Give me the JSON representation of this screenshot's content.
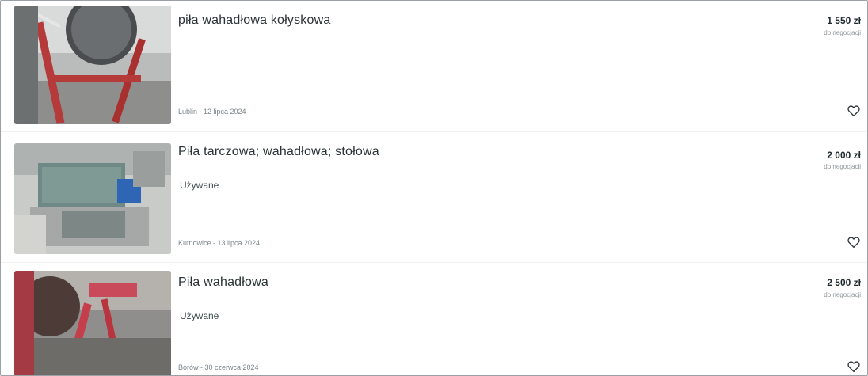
{
  "listings": [
    {
      "title": "piła wahadłowa kołyskowa",
      "condition": "",
      "location_date": "Lublin - 12 lipca 2024",
      "price": "1 550 zł",
      "negotiable": "do negocjacji",
      "favorite_icon": "heart-outline-icon"
    },
    {
      "title": "Piła tarczowa; wahadłowa; stołowa",
      "condition": "Używane",
      "location_date": "Kutnowice - 13 lipca 2024",
      "price": "2 000 zł",
      "negotiable": "do negocjacji",
      "favorite_icon": "heart-outline-icon"
    },
    {
      "title": "Piła wahadłowa",
      "condition": "Używane",
      "location_date": "Borów - 30 czerwca 2024",
      "price": "2 500 zł",
      "negotiable": "do negocjacji",
      "favorite_icon": "heart-outline-icon"
    }
  ]
}
